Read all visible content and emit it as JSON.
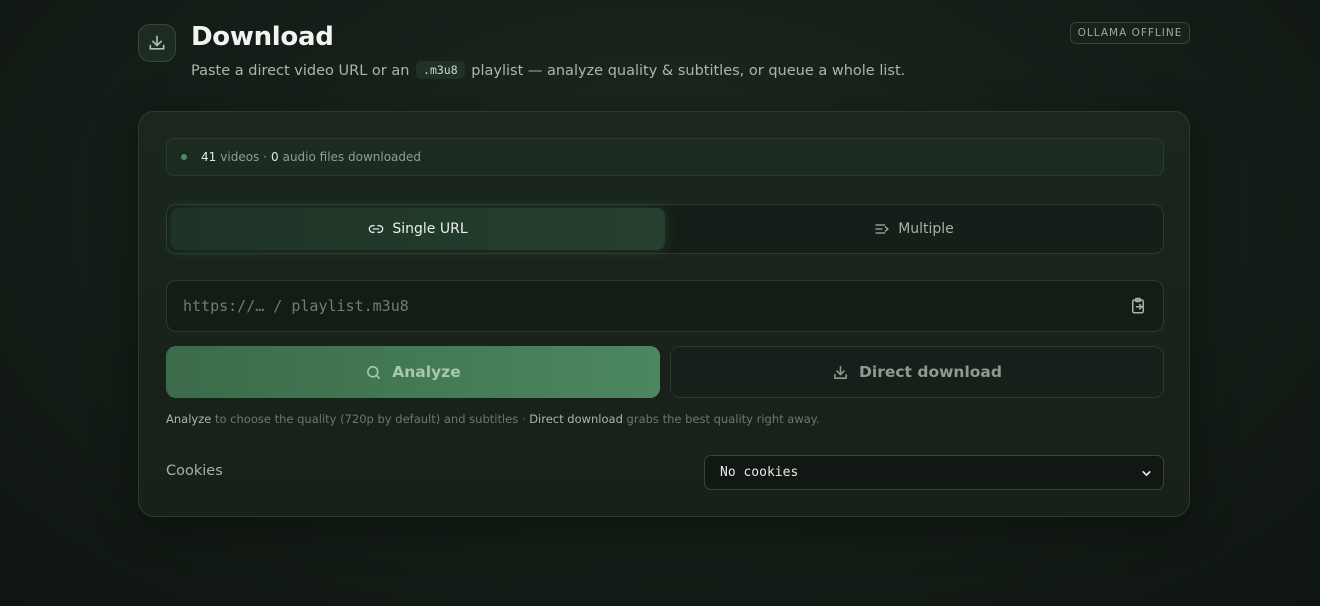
{
  "header": {
    "title": "Download",
    "subtitle_before": "Paste a direct video URL or an",
    "subtitle_code": ".m3u8",
    "subtitle_after": "playlist — analyze quality & subtitles, or queue a whole list.",
    "status_badge": "OLLAMA OFFLINE",
    "icon": "download-icon"
  },
  "stats": {
    "videos_count": "41",
    "videos_label": "videos ·",
    "audio_count": "0",
    "audio_label": "audio files downloaded"
  },
  "tabs": [
    {
      "label": "Single URL",
      "icon": "link-icon",
      "active": true
    },
    {
      "label": "Multiple",
      "icon": "list-icon",
      "active": false
    }
  ],
  "url_input": {
    "placeholder": "https://… / playlist.m3u8",
    "value": "",
    "paste_icon": "clipboard-paste-icon"
  },
  "buttons": {
    "analyze": "Analyze",
    "direct_download": "Direct download"
  },
  "hint": {
    "analyze_word": "Analyze",
    "analyze_text": "to choose the quality (720p by default) and subtitles ·",
    "direct_word": "Direct download",
    "direct_text": "grabs the best quality right away."
  },
  "cookies": {
    "label": "Cookies",
    "selected": "No cookies"
  },
  "colors": {
    "accent": "#4c8760",
    "background": "#141d17"
  }
}
